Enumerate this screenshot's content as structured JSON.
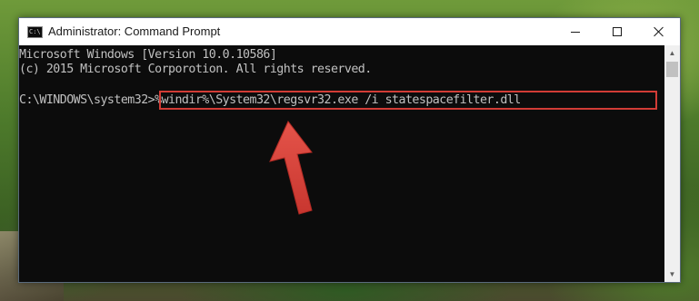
{
  "window": {
    "title": "Administrator: Command Prompt",
    "icon_label": "C:\\",
    "controls": {
      "minimize": "minimize-icon",
      "maximize": "maximize-icon",
      "close": "close-icon"
    }
  },
  "console": {
    "lines": [
      "Microsoft Windows [Version 10.0.10586]",
      "(c) 2015 Microsoft Corporotion. All rights reserved."
    ],
    "prompt": "C:\\WINDOWS\\system32>",
    "command": "%windir%\\System32\\regsvr32.exe /i statespacefilter.dll"
  },
  "scrollbar": {
    "up_arrow": "▲",
    "down_arrow": "▼"
  },
  "colors": {
    "console_bg": "#0c0c0c",
    "console_text": "#c0c0c0",
    "highlight": "#d23c36",
    "titlebar_bg": "#ffffff"
  }
}
